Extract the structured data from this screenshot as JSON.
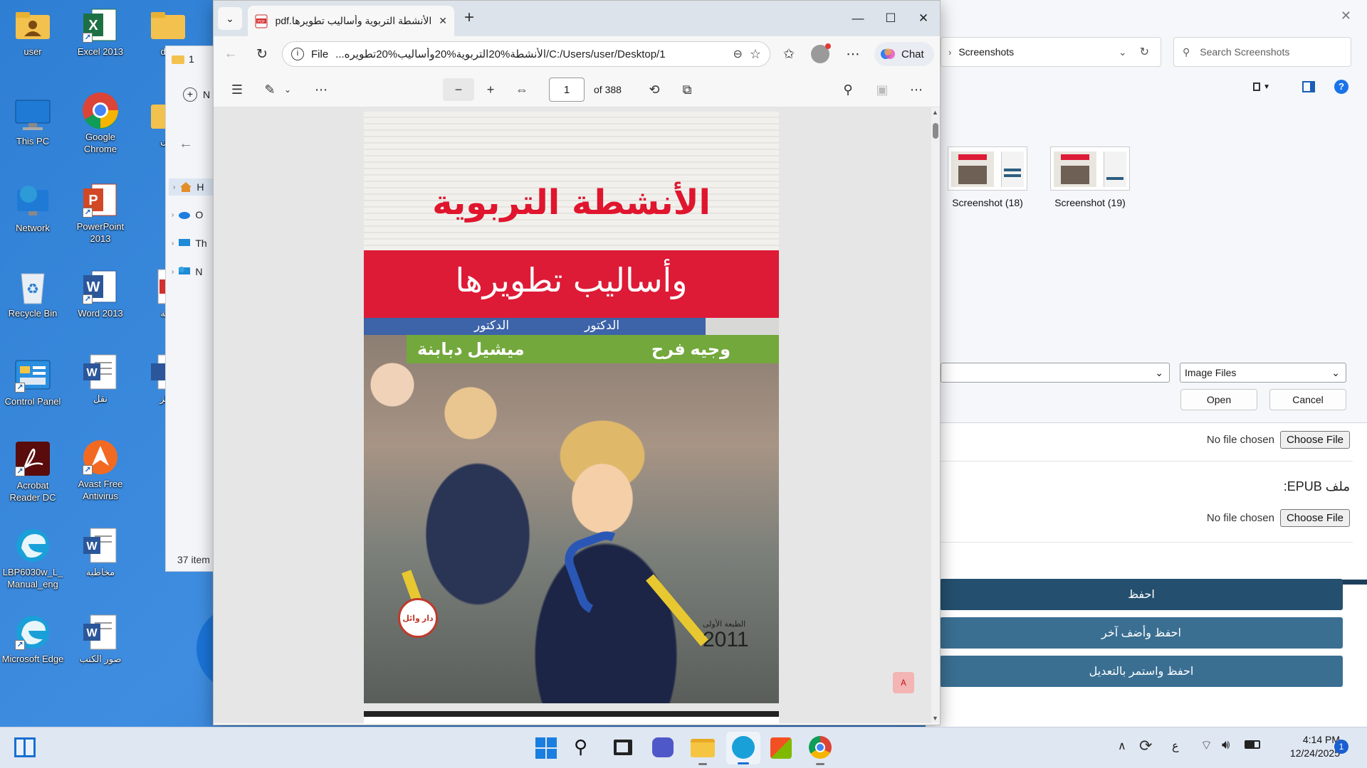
{
  "desktop": {
    "col1": [
      {
        "label": "user",
        "icon": "user-folder-icon"
      },
      {
        "label": "This PC",
        "icon": "monitor-icon"
      },
      {
        "label": "Network",
        "icon": "network-icon"
      },
      {
        "label": "Recycle Bin",
        "icon": "recycle-bin-icon"
      },
      {
        "label": "Control Panel",
        "icon": "control-panel-icon"
      },
      {
        "label": "Acrobat Reader DC",
        "icon": "acrobat-icon"
      },
      {
        "label": "LBP6030w_L_Manual_eng",
        "icon": "edge-file-icon"
      },
      {
        "label": "Microsoft Edge",
        "icon": "edge-icon"
      }
    ],
    "col2": [
      {
        "label": "Excel 2013",
        "icon": "excel-icon"
      },
      {
        "label": "Google Chrome",
        "icon": "chrome-icon"
      },
      {
        "label": "PowerPoint 2013",
        "icon": "powerpoint-icon"
      },
      {
        "label": "Word 2013",
        "icon": "word-icon"
      },
      {
        "label": "نقل",
        "icon": "word-doc-icon"
      },
      {
        "label": "Avast Free Antivirus",
        "icon": "avast-icon"
      },
      {
        "label": "مخاطبة",
        "icon": "word-doc-icon"
      },
      {
        "label": "صور الكتب",
        "icon": "word-doc-icon"
      }
    ],
    "col3_partial": [
      {
        "label": "des",
        "icon": "folder-icon"
      },
      {
        "label": "زون",
        "icon": "folder-icon"
      },
      {
        "label": "وجة",
        "icon": "pdf-icon"
      },
      {
        "label": "راكز",
        "icon": "word-doc-icon"
      }
    ]
  },
  "explorer": {
    "tab_label": "1",
    "new_label": "N",
    "nav_items": [
      "H",
      "O",
      "Th",
      "N"
    ],
    "status": "37 item"
  },
  "edge": {
    "tab_title": "الأنشطة التربوية وأساليب تطويرها.pdf",
    "url_prefix": "File",
    "url_text": "C:/Users/user/Desktop/1/الأنشطة%20التربوية%20وأساليب%20تطويره...",
    "chat_label": "Chat",
    "page_current": "1",
    "page_total": "of 388"
  },
  "book": {
    "title_line1": "الأنشطة التربوية",
    "title_line2": "وأساليب تطويرها",
    "doctor_label1": "الدكتور",
    "doctor_label2": "الدكتور",
    "author1": "وجيه فرح",
    "author2": "ميشيل دبابنة",
    "edition": "الطبعة الأولى",
    "year": "2011",
    "publisher": "دار وائل"
  },
  "file_dialog": {
    "address": "Screenshots",
    "search_placeholder": "Search Screenshots",
    "files": [
      {
        "name": "Screenshot (18)"
      },
      {
        "name": "Screenshot (19)"
      }
    ],
    "filetype": "Image Files",
    "open_label": "Open",
    "cancel_label": "Cancel"
  },
  "web_form": {
    "no_file": "No file chosen",
    "choose_file": "Choose File",
    "epub_label": "ملف EPUB:",
    "save_label": "احفظ",
    "save_add_label": "احفظ وأضف آخر",
    "save_continue_label": "احفظ واستمر بالتعديل"
  },
  "taskbar": {
    "time": "4:14 PM",
    "date": "12/24/2025",
    "lang": "ع",
    "notification_count": "1"
  },
  "colors": {
    "edge_tab_bg": "#dde3ea",
    "form_button": "#2c5d80",
    "book_red": "#dd1b36",
    "book_green": "#73a83c",
    "book_blue": "#3d63a8"
  }
}
